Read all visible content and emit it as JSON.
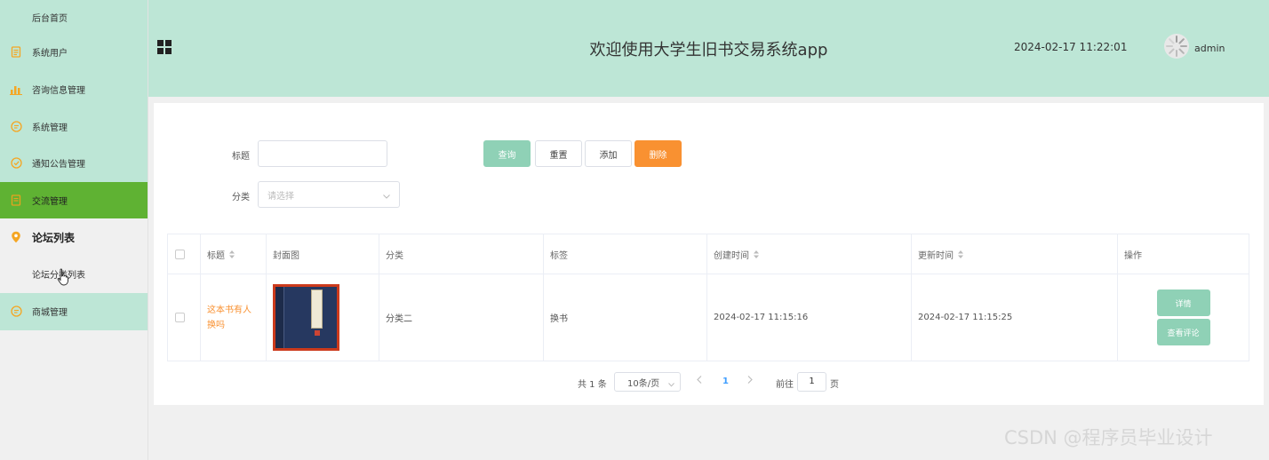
{
  "sidebar": {
    "items": [
      {
        "label": "后台首页",
        "icon": ""
      },
      {
        "label": "系统用户",
        "icon": "document-icon"
      },
      {
        "label": "咨询信息管理",
        "icon": "bar-chart-icon"
      },
      {
        "label": "系统管理",
        "icon": "chat-icon"
      },
      {
        "label": "通知公告管理",
        "icon": "check-circle-icon"
      },
      {
        "label": "交流管理",
        "icon": "document-icon"
      },
      {
        "label": "论坛列表",
        "icon": "location-pin-icon"
      },
      {
        "label": "论坛分类列表",
        "icon": ""
      },
      {
        "label": "商城管理",
        "icon": "chat-icon"
      }
    ]
  },
  "header": {
    "title": "欢迎使用大学生旧书交易系统app",
    "datetime": "2024-02-17 11:22:01",
    "user": "admin"
  },
  "filters": {
    "title_label": "标题",
    "title_value": "",
    "category_label": "分类",
    "category_placeholder": "请选择"
  },
  "buttons": {
    "search": "查询",
    "reset": "重置",
    "add": "添加",
    "delete": "删除"
  },
  "table": {
    "headers": [
      "标题",
      "封面图",
      "分类",
      "标签",
      "创建时间",
      "更新时间",
      "操作"
    ],
    "rows": [
      {
        "title": "这本书有人换吗",
        "category": "分类二",
        "tag": "换书",
        "created": "2024-02-17 11:15:16",
        "updated": "2024-02-17 11:15:25",
        "action_detail": "详情",
        "action_comments": "查看评论"
      }
    ]
  },
  "pagination": {
    "total": "共 1 条",
    "page_size": "10条/页",
    "current_page": "1",
    "goto_label": "前往",
    "goto_value": "1",
    "page_suffix": "页"
  },
  "watermark": "CSDN @程序员毕业设计",
  "colors": {
    "header_bg": "#bde6d6",
    "active_menu": "#5fb233",
    "primary_btn": "#8fd1b6",
    "danger_btn": "#f99131",
    "icon_orange": "#f5a623"
  }
}
